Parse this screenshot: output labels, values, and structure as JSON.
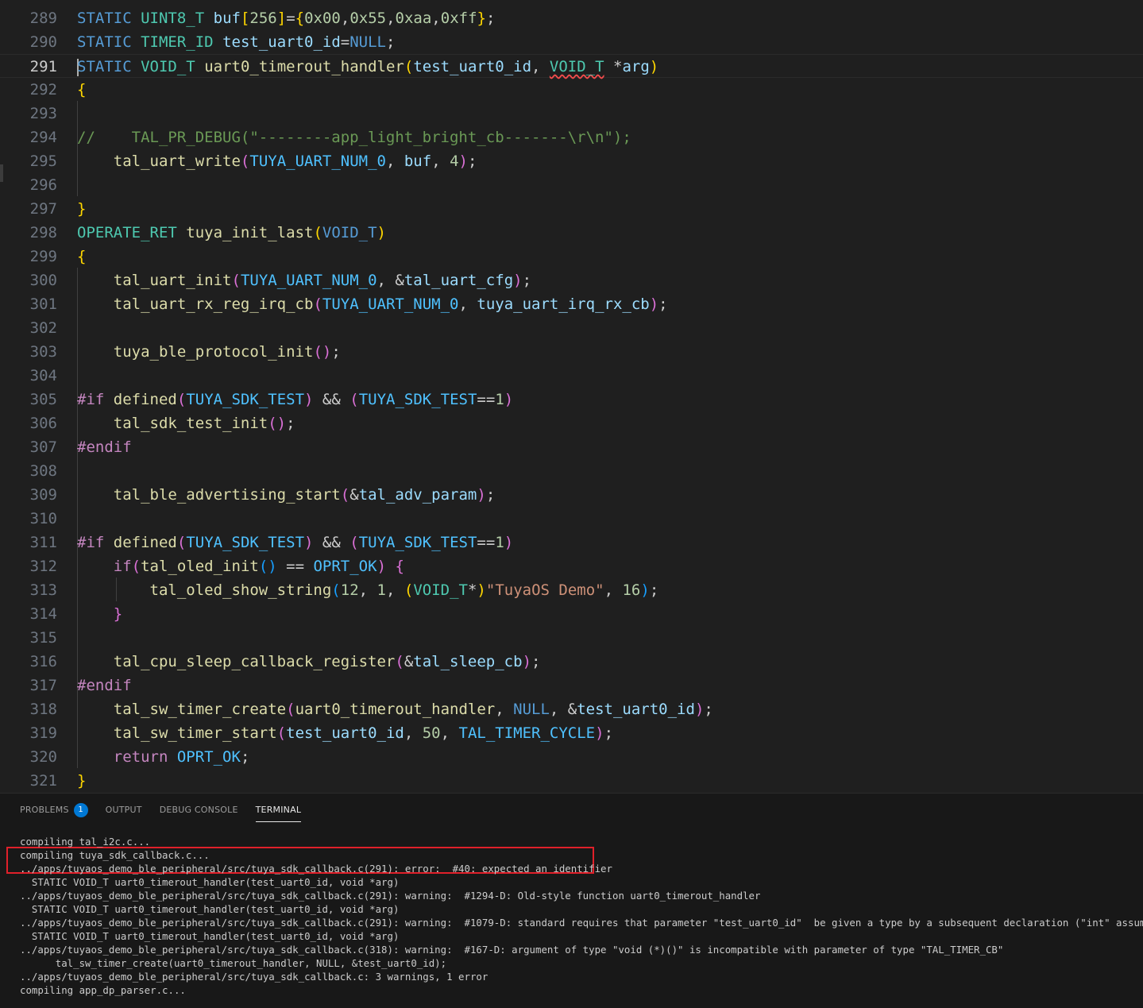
{
  "editor": {
    "current_line": "291",
    "lines": [
      {
        "num": "289"
      },
      {
        "num": "290"
      },
      {
        "num": "291"
      },
      {
        "num": "292"
      },
      {
        "num": "293"
      },
      {
        "num": "294"
      },
      {
        "num": "295"
      },
      {
        "num": "296"
      },
      {
        "num": "297"
      },
      {
        "num": "298"
      },
      {
        "num": "299"
      },
      {
        "num": "300"
      },
      {
        "num": "301"
      },
      {
        "num": "302"
      },
      {
        "num": "303"
      },
      {
        "num": "304"
      },
      {
        "num": "305"
      },
      {
        "num": "306"
      },
      {
        "num": "307"
      },
      {
        "num": "308"
      },
      {
        "num": "309"
      },
      {
        "num": "310"
      },
      {
        "num": "311"
      },
      {
        "num": "312"
      },
      {
        "num": "313"
      },
      {
        "num": "314"
      },
      {
        "num": "315"
      },
      {
        "num": "316"
      },
      {
        "num": "317"
      },
      {
        "num": "318"
      },
      {
        "num": "319"
      },
      {
        "num": "320"
      },
      {
        "num": "321"
      }
    ]
  },
  "panel": {
    "tabs": {
      "problems": "PROBLEMS",
      "problems_count": "1",
      "output": "OUTPUT",
      "debug_console": "DEBUG CONSOLE",
      "terminal": "TERMINAL"
    },
    "terminal_lines": [
      "compiling tal_i2c.c...",
      "compiling tuya_sdk_callback.c...",
      "../apps/tuyaos_demo_ble_peripheral/src/tuya_sdk_callback.c(291): error:  #40: expected an identifier",
      "  STATIC VOID_T uart0_timerout_handler(test_uart0_id, void *arg)",
      "../apps/tuyaos_demo_ble_peripheral/src/tuya_sdk_callback.c(291): warning:  #1294-D: Old-style function uart0_timerout_handler",
      "  STATIC VOID_T uart0_timerout_handler(test_uart0_id, void *arg)",
      "../apps/tuyaos_demo_ble_peripheral/src/tuya_sdk_callback.c(291): warning:  #1079-D: standard requires that parameter \"test_uart0_id\"  be given a type by a subsequent declaration (\"int\" assumed)",
      "  STATIC VOID_T uart0_timerout_handler(test_uart0_id, void *arg)",
      "../apps/tuyaos_demo_ble_peripheral/src/tuya_sdk_callback.c(318): warning:  #167-D: argument of type \"void (*)()\" is incompatible with parameter of type \"TAL_TIMER_CB\"",
      "      tal_sw_timer_create(uart0_timerout_handler, NULL, &test_uart0_id);",
      "../apps/tuyaos_demo_ble_peripheral/src/tuya_sdk_callback.c: 3 warnings, 1 error",
      "compiling app_dp_parser.c..."
    ]
  },
  "colors": {
    "editor_bg": "#1f1f1f",
    "panel_bg": "#181818",
    "highlight_box": "#e0202a",
    "badge": "#0078d4"
  }
}
